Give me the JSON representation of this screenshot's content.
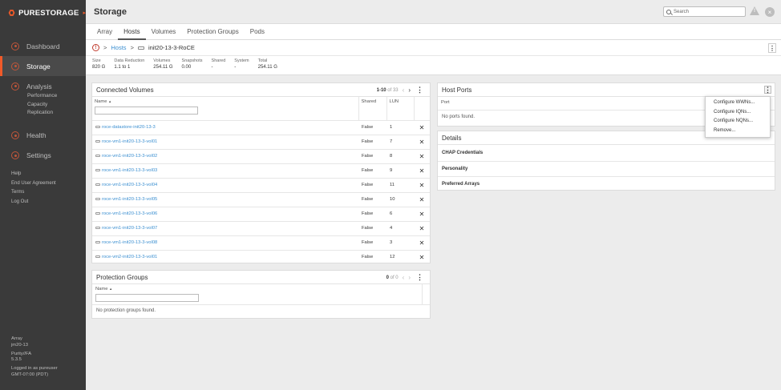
{
  "brand": {
    "name": "PURESTORAGE",
    "accent": "#f15a29"
  },
  "sidebar": {
    "items": [
      {
        "label": "Dashboard"
      },
      {
        "label": "Storage"
      },
      {
        "label": "Analysis",
        "sub": [
          "Performance",
          "Capacity",
          "Replication"
        ]
      },
      {
        "label": "Health"
      },
      {
        "label": "Settings"
      }
    ],
    "links": [
      "Help",
      "End User Agreement",
      "Terms",
      "Log Out"
    ],
    "footer": {
      "array_label": "Array",
      "array_value": "jm20-13",
      "purity_label": "Purity//FA",
      "purity_value": "5.3.5",
      "logged_in": "Logged in as pureuser",
      "timezone": "GMT-07:00 (PDT)"
    }
  },
  "header": {
    "title": "Storage",
    "search_placeholder": "Search"
  },
  "tabs": [
    "Array",
    "Hosts",
    "Volumes",
    "Protection Groups",
    "Pods"
  ],
  "breadcrumb": {
    "parent": "Hosts",
    "current": "init20-13-3-RoCE"
  },
  "stats": [
    {
      "label": "Size",
      "value": "820 G"
    },
    {
      "label": "Data Reduction",
      "value": "1.1 to 1"
    },
    {
      "label": "Volumes",
      "value": "254.11 G"
    },
    {
      "label": "Snapshots",
      "value": "0.00"
    },
    {
      "label": "Shared",
      "value": "-"
    },
    {
      "label": "System",
      "value": "-"
    },
    {
      "label": "Total",
      "value": "254.11 G"
    }
  ],
  "connected_volumes": {
    "title": "Connected Volumes",
    "pager": "1-10",
    "pager_of": "of 33",
    "columns": {
      "name": "Name",
      "shared": "Shared",
      "lun": "LUN"
    },
    "rows": [
      {
        "name": "roce-datastore-init20-13-3",
        "shared": "False",
        "lun": "1"
      },
      {
        "name": "roce-vm1-init20-13-3-vol01",
        "shared": "False",
        "lun": "7"
      },
      {
        "name": "roce-vm1-init20-13-3-vol02",
        "shared": "False",
        "lun": "8"
      },
      {
        "name": "roce-vm1-init20-13-3-vol03",
        "shared": "False",
        "lun": "9"
      },
      {
        "name": "roce-vm1-init20-13-3-vol04",
        "shared": "False",
        "lun": "11"
      },
      {
        "name": "roce-vm1-init20-13-3-vol05",
        "shared": "False",
        "lun": "10"
      },
      {
        "name": "roce-vm1-init20-13-3-vol06",
        "shared": "False",
        "lun": "6"
      },
      {
        "name": "roce-vm1-init20-13-3-vol07",
        "shared": "False",
        "lun": "4"
      },
      {
        "name": "roce-vm1-init20-13-3-vol08",
        "shared": "False",
        "lun": "3"
      },
      {
        "name": "roce-vm2-init20-13-3-vol01",
        "shared": "False",
        "lun": "12"
      }
    ]
  },
  "protection_groups": {
    "title": "Protection Groups",
    "pager": "0",
    "pager_of": "of 0",
    "column": "Name",
    "empty": "No protection groups found."
  },
  "host_ports": {
    "title": "Host Ports",
    "column": "Port",
    "empty": "No ports found."
  },
  "details": {
    "title": "Details",
    "rows": [
      "CHAP Credentials",
      "Personality",
      "Preferred Arrays"
    ]
  },
  "menu": [
    "Configure WWNs...",
    "Configure IQNs...",
    "Configure NQNs...",
    "Remove..."
  ]
}
